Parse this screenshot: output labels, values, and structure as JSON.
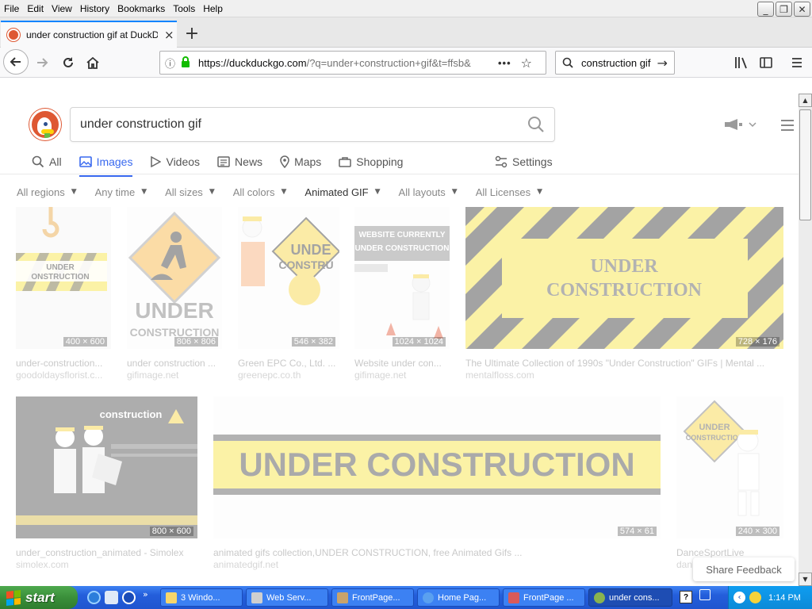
{
  "menubar": {
    "items": [
      "File",
      "Edit",
      "View",
      "History",
      "Bookmarks",
      "Tools",
      "Help"
    ],
    "accelerators": [
      "F",
      "E",
      "V",
      "s",
      "B",
      "T",
      "H"
    ]
  },
  "window_controls": {
    "minimize": "_",
    "restore": "❐",
    "close": "✕"
  },
  "tab": {
    "title": "under construction gif at DuckDuckGo",
    "close": "×",
    "new_tab": "+"
  },
  "nav": {
    "url_host": "https://duckduckgo.com",
    "url_rest": "/?q=under+construction+gif&t=ffsb&",
    "more": "•••",
    "search_value": "construction gif"
  },
  "search": {
    "query": "under construction gif",
    "tabs": [
      "All",
      "Images",
      "Videos",
      "News",
      "Maps",
      "Shopping"
    ],
    "active_tab": "Images",
    "settings": "Settings"
  },
  "filters": [
    {
      "label": "All regions",
      "on": false
    },
    {
      "label": "Any time",
      "on": false
    },
    {
      "label": "All sizes",
      "on": false
    },
    {
      "label": "All colors",
      "on": false
    },
    {
      "label": "Animated GIF",
      "on": true
    },
    {
      "label": "All layouts",
      "on": false
    },
    {
      "label": "All Licenses",
      "on": false
    }
  ],
  "results": [
    {
      "title": "under-construction...",
      "source": "goodoldaysflorist.c...",
      "dims": "400 × 600",
      "art": "UNDER CONSTRUCTION"
    },
    {
      "title": "under construction ...",
      "source": "gifimage.net",
      "dims": "806 × 806",
      "art": "UNDER CONSTRUCTION"
    },
    {
      "title": "Green EPC Co., Ltd. ...",
      "source": "greenepc.co.th",
      "dims": "546 × 382",
      "art": "UNDER CONSTRU"
    },
    {
      "title": "Website under con...",
      "source": "gifimage.net",
      "dims": "1024 × 1024",
      "art": "WEBSITE CURRENTLY UNDER CONSTRUCTION"
    },
    {
      "title": "The Ultimate Collection of 1990s \"Under Construction\" GIFs | Mental ...",
      "source": "mentalfloss.com",
      "dims": "728 × 176",
      "art": "UNDER CONSTRUCTION"
    },
    {
      "title": "under_construction_animated - Simolex",
      "source": "simolex.com",
      "dims": "800 × 600",
      "art": "construction"
    },
    {
      "title": "animated gifs collection,UNDER CONSTRUCTION, free Animated Gifs ...",
      "source": "animatedgif.net",
      "dims": "574 × 61",
      "art": "UNDER CONSTRUCTION"
    },
    {
      "title": "DanceSportLive",
      "source": "dan...",
      "dims": "240 × 300",
      "art": "UNDER CONSTRUCTION"
    }
  ],
  "feedback": "Share Feedback",
  "taskbar": {
    "start": "start",
    "buttons": [
      "3 Windo...",
      "Web Serv...",
      "FrontPage...",
      "Home Pag...",
      "FrontPage ...",
      "under cons..."
    ],
    "clock": "1:14 PM"
  },
  "colors": {
    "accent": "#3969ef",
    "ddg_orange": "#de5833",
    "caution_yellow": "#f5e23b",
    "xp_blue": "#245edb",
    "xp_green": "#3a8f3a"
  }
}
